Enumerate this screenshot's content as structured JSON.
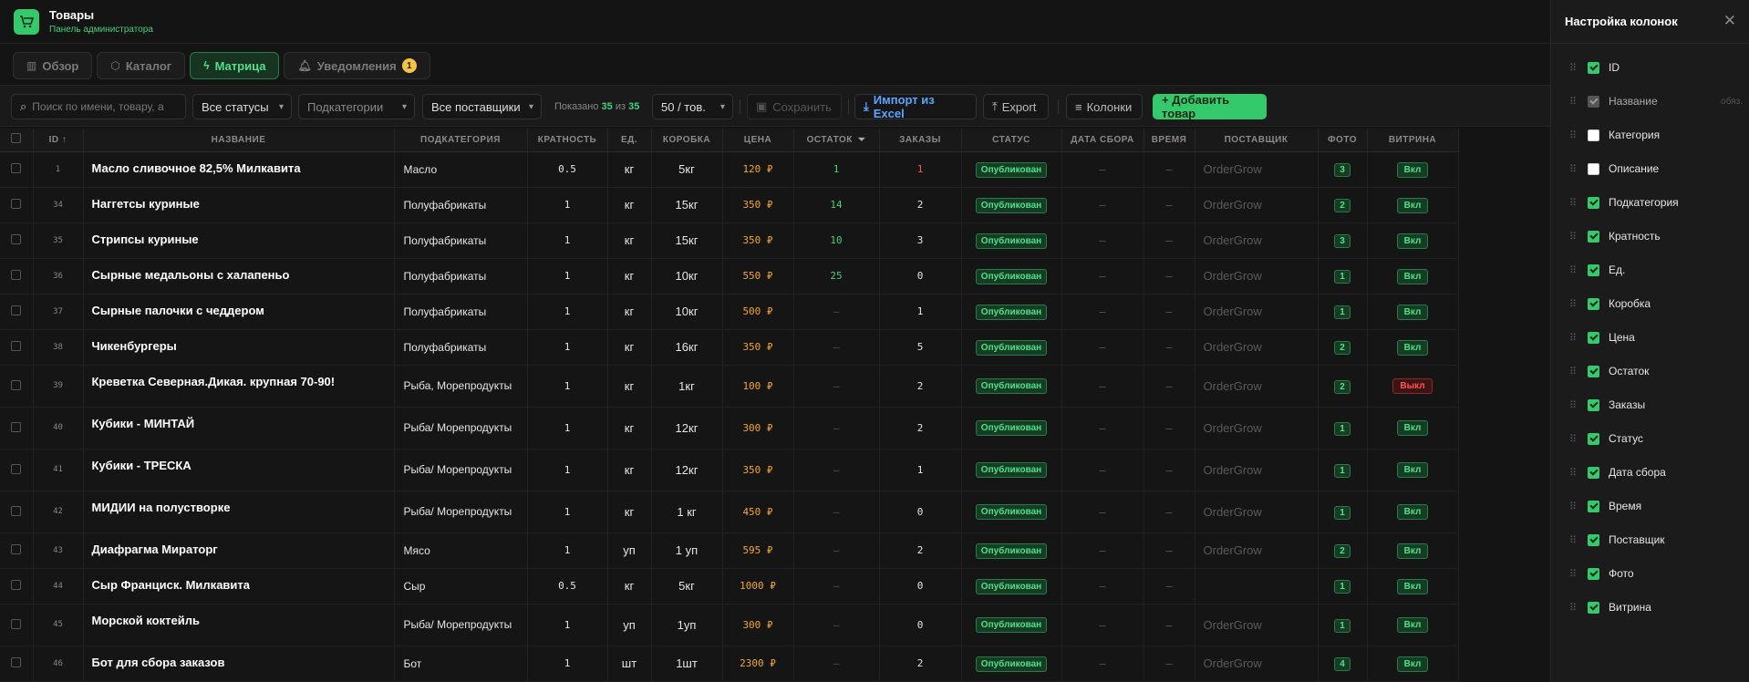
{
  "app": {
    "title": "Товары",
    "subtitle": "Панель администратора"
  },
  "tabs": [
    {
      "label": "Обзор",
      "icon": "chart-icon"
    },
    {
      "label": "Каталог",
      "icon": "box-icon"
    },
    {
      "label": "Матрица",
      "icon": "bolt-icon"
    },
    {
      "label": "Уведомления",
      "icon": "bell-icon",
      "badge": "1"
    }
  ],
  "toolbar": {
    "search_placeholder": "Поиск по имени, товару, а",
    "status": "Все статусы",
    "subcategory": "Подкатегории",
    "supplier": "Все поставщики",
    "shown_label": "Показано",
    "shown": "35",
    "of": "из",
    "total": "35",
    "per_page": "50 / тов.",
    "save": "Сохранить",
    "import": "Импорт из Excel",
    "export": "Export",
    "columns": "Колонки",
    "add": "+ Добавить товар"
  },
  "columns": [
    "ID ↑",
    "НАЗВАНИЕ",
    "ПОДКАТЕГОРИЯ",
    "КРАТНОСТЬ",
    "ЕД.",
    "КОРОБКА",
    "ЦЕНА",
    "ОСТАТОК",
    "ЗАКАЗЫ",
    "СТАТУС",
    "ДАТА СБОРА",
    "ВРЕМЯ",
    "ПОСТАВЩИК",
    "ФОТО",
    "ВИТРИНА"
  ],
  "rows": [
    {
      "id": "1",
      "name": "Масло сливочное 82,5% Милкавита",
      "sub": "Масло",
      "mult": "0.5",
      "unit": "кг",
      "box": "5кг",
      "price": "120 ₽",
      "stock": "1",
      "orders": "1",
      "status": "Опубликован",
      "date": "–",
      "time": "–",
      "supplier": "OrderGrow",
      "photo": "3",
      "vitrina": "Вкл"
    },
    {
      "id": "34",
      "name": "Наггетсы куриные",
      "sub": "Полуфабрикаты",
      "mult": "1",
      "unit": "кг",
      "box": "15кг",
      "price": "350 ₽",
      "stock": "14",
      "orders": "2",
      "status": "Опубликован",
      "date": "–",
      "time": "–",
      "supplier": "OrderGrow",
      "photo": "2",
      "vitrina": "Вкл"
    },
    {
      "id": "35",
      "name": "Стрипсы куриные",
      "sub": "Полуфабрикаты",
      "mult": "1",
      "unit": "кг",
      "box": "15кг",
      "price": "350 ₽",
      "stock": "10",
      "orders": "3",
      "status": "Опубликован",
      "date": "–",
      "time": "–",
      "supplier": "OrderGrow",
      "photo": "3",
      "vitrina": "Вкл"
    },
    {
      "id": "36",
      "name": "Сырные медальоны с халапеньо",
      "sub": "Полуфабрикаты",
      "mult": "1",
      "unit": "кг",
      "box": "10кг",
      "price": "550 ₽",
      "stock": "25",
      "orders": "0",
      "status": "Опубликован",
      "date": "–",
      "time": "–",
      "supplier": "OrderGrow",
      "photo": "1",
      "vitrina": "Вкл"
    },
    {
      "id": "37",
      "name": "Сырные палочки с чеддером",
      "sub": "Полуфабрикаты",
      "mult": "1",
      "unit": "кг",
      "box": "10кг",
      "price": "500 ₽",
      "stock": "—",
      "orders": "1",
      "status": "Опубликован",
      "date": "–",
      "time": "–",
      "supplier": "OrderGrow",
      "photo": "1",
      "vitrina": "Вкл"
    },
    {
      "id": "38",
      "name": "Чикенбургеры",
      "sub": "Полуфабрикаты",
      "mult": "1",
      "unit": "кг",
      "box": "16кг",
      "price": "350 ₽",
      "stock": "—",
      "orders": "5",
      "status": "Опубликован",
      "date": "–",
      "time": "–",
      "supplier": "OrderGrow",
      "photo": "2",
      "vitrina": "Вкл"
    },
    {
      "id": "39",
      "name": "Креветка Северная.Дикая. крупная 70-90!",
      "sub": "Рыба, Морепродукты",
      "mult": "1",
      "unit": "кг",
      "box": "1кг",
      "price": "100 ₽",
      "stock": "—",
      "orders": "2",
      "status": "Опубликован",
      "date": "–",
      "time": "–",
      "supplier": "OrderGrow",
      "photo": "2",
      "vitrina": "Выкл"
    },
    {
      "id": "40",
      "name": "Кубики - МИНТАЙ",
      "sub": "Рыба/ Морепродукты",
      "mult": "1",
      "unit": "кг",
      "box": "12кг",
      "price": "300 ₽",
      "stock": "—",
      "orders": "2",
      "status": "Опубликован",
      "date": "–",
      "time": "–",
      "supplier": "OrderGrow",
      "photo": "1",
      "vitrina": "Вкл"
    },
    {
      "id": "41",
      "name": "Кубики - ТРЕСКА",
      "sub": "Рыба/ Морепродукты",
      "mult": "1",
      "unit": "кг",
      "box": "12кг",
      "price": "350 ₽",
      "stock": "—",
      "orders": "1",
      "status": "Опубликован",
      "date": "–",
      "time": "–",
      "supplier": "OrderGrow",
      "photo": "1",
      "vitrina": "Вкл"
    },
    {
      "id": "42",
      "name": "МИДИИ на полустворке",
      "sub": "Рыба/ Морепродукты",
      "mult": "1",
      "unit": "кг",
      "box": "1 кг",
      "price": "450 ₽",
      "stock": "—",
      "orders": "0",
      "status": "Опубликован",
      "date": "–",
      "time": "–",
      "supplier": "OrderGrow",
      "photo": "1",
      "vitrina": "Вкл"
    },
    {
      "id": "43",
      "name": "Диафрагма Мираторг",
      "sub": "Мясо",
      "mult": "1",
      "unit": "уп",
      "box": "1 уп",
      "price": "595 ₽",
      "stock": "—",
      "orders": "2",
      "status": "Опубликован",
      "date": "–",
      "time": "–",
      "supplier": "OrderGrow",
      "photo": "2",
      "vitrina": "Вкл"
    },
    {
      "id": "44",
      "name": "Сыр Франциск. Милкавита",
      "sub": "Сыр",
      "mult": "0.5",
      "unit": "кг",
      "box": "5кг",
      "price": "1000 ₽",
      "stock": "—",
      "orders": "0",
      "status": "Опубликован",
      "date": "–",
      "time": "–",
      "supplier": "",
      "photo": "1",
      "vitrina": "Вкл"
    },
    {
      "id": "45",
      "name": "Морской коктейль",
      "sub": "Рыба/ Морепродукты",
      "mult": "1",
      "unit": "уп",
      "box": "1уп",
      "price": "300 ₽",
      "stock": "—",
      "orders": "0",
      "status": "Опубликован",
      "date": "–",
      "time": "–",
      "supplier": "OrderGrow",
      "photo": "1",
      "vitrina": "Вкл"
    },
    {
      "id": "46",
      "name": "Бот для сбора заказов",
      "sub": "Бот",
      "mult": "1",
      "unit": "шт",
      "box": "1шт",
      "price": "2300 ₽",
      "stock": "—",
      "orders": "2",
      "status": "Опубликован",
      "date": "–",
      "time": "–",
      "supplier": "OrderGrow",
      "photo": "4",
      "vitrina": "Вкл"
    }
  ],
  "panel": {
    "title": "Настройка колонок",
    "items": [
      {
        "label": "ID",
        "state": "checked"
      },
      {
        "label": "Название",
        "state": "disabled",
        "note": "обяз."
      },
      {
        "label": "Категория",
        "state": "unchecked"
      },
      {
        "label": "Описание",
        "state": "unchecked"
      },
      {
        "label": "Подкатегория",
        "state": "checked"
      },
      {
        "label": "Кратность",
        "state": "checked"
      },
      {
        "label": "Ед.",
        "state": "checked"
      },
      {
        "label": "Коробка",
        "state": "checked"
      },
      {
        "label": "Цена",
        "state": "checked"
      },
      {
        "label": "Остаток",
        "state": "checked"
      },
      {
        "label": "Заказы",
        "state": "checked"
      },
      {
        "label": "Статус",
        "state": "checked"
      },
      {
        "label": "Дата сбора",
        "state": "checked"
      },
      {
        "label": "Время",
        "state": "checked"
      },
      {
        "label": "Поставщик",
        "state": "checked"
      },
      {
        "label": "Фото",
        "state": "checked"
      },
      {
        "label": "Витрина",
        "state": "checked"
      }
    ]
  },
  "colors": {
    "accent": "#34c96a",
    "price": "#f5a623",
    "danger": "#ff5555",
    "link": "#5aa6ff"
  }
}
